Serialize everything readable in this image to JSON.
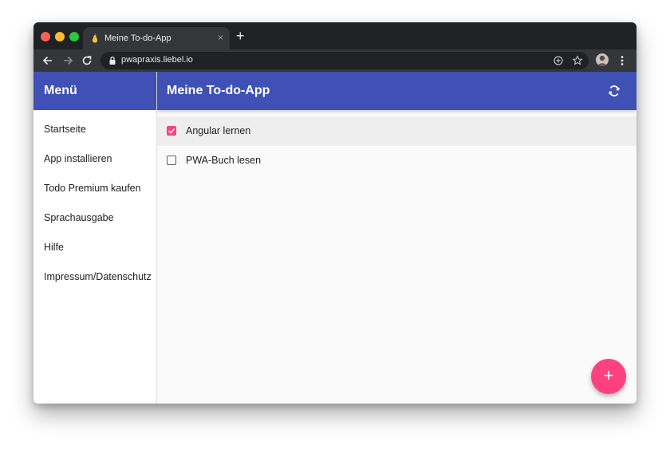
{
  "browser": {
    "tab_title": "Meine To-do-App",
    "tab_close": "×",
    "new_tab": "+",
    "url": "pwapraxis.liebel.io"
  },
  "sidenav": {
    "title": "Menü",
    "items": [
      {
        "label": "Startseite"
      },
      {
        "label": "App installieren"
      },
      {
        "label": "Todo Premium kaufen"
      },
      {
        "label": "Sprachausgabe"
      },
      {
        "label": "Hilfe"
      },
      {
        "label": "Impressum/Datenschutz"
      }
    ]
  },
  "main": {
    "title": "Meine To-do-App",
    "todos": [
      {
        "label": "Angular lernen",
        "done": true
      },
      {
        "label": "PWA-Buch lesen",
        "done": false
      }
    ],
    "fab_label": "+"
  },
  "colors": {
    "primary": "#3f51b5",
    "accent": "#ff4081",
    "browser_dark": "#202124",
    "browser_toolbar": "#35363a"
  }
}
